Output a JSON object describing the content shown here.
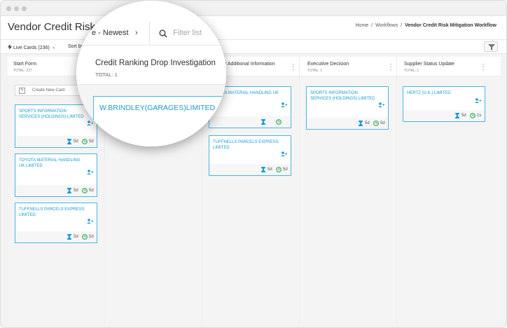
{
  "window": {
    "title": "Vendor Credit Risk Mitigation Workflow"
  },
  "breadcrumb": {
    "home": "Home",
    "sep1": "/",
    "workflows": "Workflows",
    "sep2": "/",
    "current": "Vendor Credit Risk Mitigation Workflow"
  },
  "toolbar": {
    "live_cards": "Live Cards (236)",
    "sort_by": "Sort by: Ti"
  },
  "magnifier": {
    "sort_value": "e - Newest",
    "search_placeholder": "Filter list",
    "column_title": "Credit Ranking Drop Investigation",
    "column_total": "TOTAL: 1",
    "card_name": "W.BRINDLEY(GARAGES)LIMITED"
  },
  "columns": [
    {
      "title": "Start Form",
      "total": "TOTAL: 227",
      "new_card_label": "Create New Card",
      "cards": [
        {
          "name": "SPORTS INFORMATION SERVICES (HOLDINGS) LIMITED",
          "time1": "5d",
          "time2": "5d"
        },
        {
          "name": "TOYOTA MATERIAL HANDLING UK LIMITED",
          "time1": "5d",
          "time2": "5d"
        },
        {
          "name": "TUFFNELLS PARCELS EXPRESS LIMITED",
          "time1": "5d",
          "time2": "5d"
        }
      ]
    },
    {
      "title": "",
      "total": "",
      "cards": []
    },
    {
      "title": "r Additional Information",
      "total": "",
      "cards": [
        {
          "name": "OYOTA MATERIAL HANDLING UK",
          "time1": "",
          "time2": ""
        },
        {
          "name": "TUFFNELLS PARCELS EXPRESS LIMITED",
          "time1": "5d",
          "time2": "5d"
        }
      ]
    },
    {
      "title": "Executive Decision",
      "total": "TOTAL: 1",
      "cards": [
        {
          "name": "SPORTS INFORMATION SERVICES (HOLDINGS) LIMITED",
          "time1": "5d",
          "time2": "5d"
        }
      ]
    },
    {
      "title": "Supplier Status Update",
      "total": "TOTAL: 1",
      "cards": [
        {
          "name": "HERTZ (U.K.) LIMITED",
          "time1": "5d",
          "time2": "1s"
        }
      ]
    }
  ],
  "colors": {
    "accent": "#1c9bd1",
    "card_border": "#4ab6e3",
    "clock": "#3aaa5c",
    "new_card_bar": "#6cc04a"
  },
  "icons": [
    "lightning-icon",
    "chevron-right-icon",
    "filter-icon",
    "user-assign-icon",
    "hourglass-icon",
    "clock-icon",
    "search-icon",
    "kebab-menu-icon"
  ]
}
